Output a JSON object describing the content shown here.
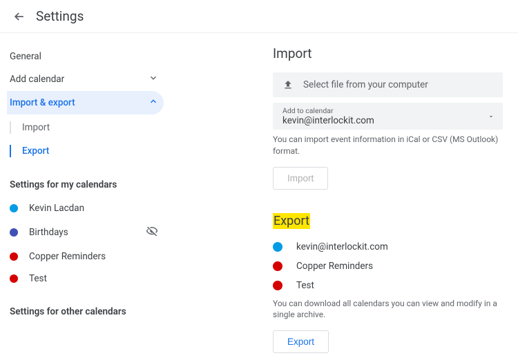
{
  "header": {
    "title": "Settings"
  },
  "sidebar": {
    "general": "General",
    "add_calendar": "Add calendar",
    "import_export": "Import & export",
    "sub": {
      "import": "Import",
      "export": "Export"
    },
    "heading_my": "Settings for my calendars",
    "calendars": [
      {
        "label": "Kevin Lacdan",
        "color": "#039be5",
        "hidden": false
      },
      {
        "label": "Birthdays",
        "color": "#3f51b5",
        "hidden": true
      },
      {
        "label": "Copper Reminders",
        "color": "#d50000",
        "hidden": false
      },
      {
        "label": "Test",
        "color": "#d50000",
        "hidden": false
      }
    ],
    "heading_other": "Settings for other calendars"
  },
  "main": {
    "import": {
      "title": "Import",
      "select_file": "Select file from your computer",
      "dd_label": "Add to calendar",
      "dd_value": "kevin@interlockit.com",
      "hint": "You can import event information in iCal or CSV (MS Outlook) format.",
      "button": "Import"
    },
    "export": {
      "title": "Export",
      "calendars": [
        {
          "label": "kevin@interlockit.com",
          "color": "#039be5"
        },
        {
          "label": "Copper Reminders",
          "color": "#d50000"
        },
        {
          "label": "Test",
          "color": "#d50000"
        }
      ],
      "hint": "You can download all calendars you can view and modify in a single archive.",
      "button": "Export"
    }
  }
}
